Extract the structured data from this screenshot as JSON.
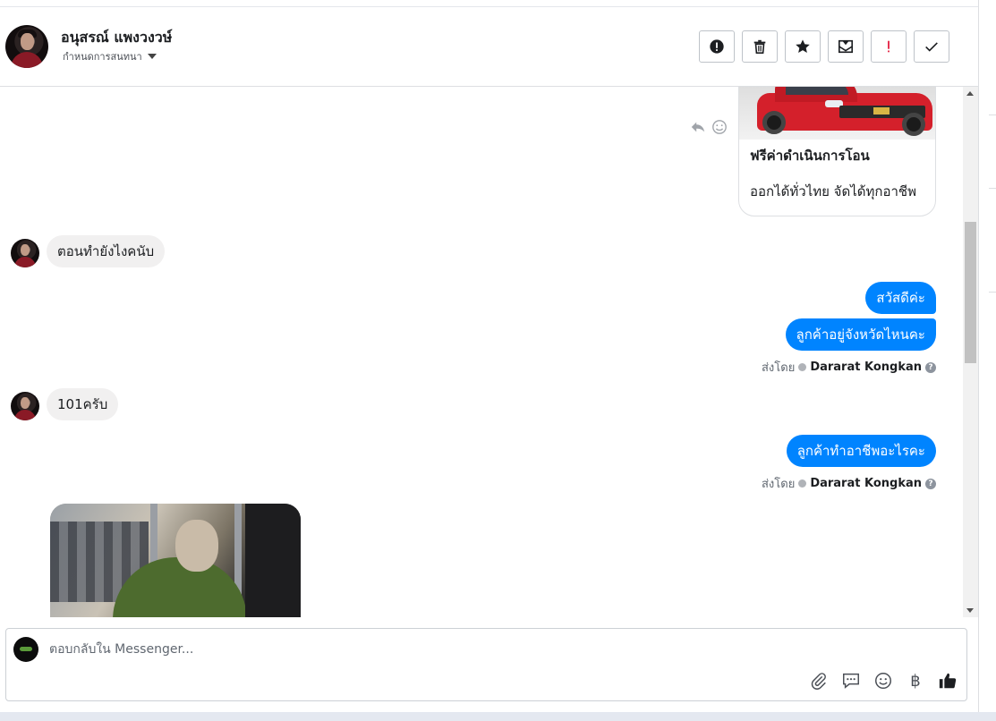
{
  "header": {
    "contact_name": "อนุสรณ์ แพงวงวษ์",
    "sub_label": "กำหนดการสนทนา",
    "toolbar": [
      {
        "icon": "alert-circle-icon"
      },
      {
        "icon": "trash-icon"
      },
      {
        "icon": "star-icon"
      },
      {
        "icon": "mark-unread-icon"
      },
      {
        "icon": "exclamation-icon"
      },
      {
        "icon": "check-icon"
      }
    ]
  },
  "card": {
    "title": "ฟรีค่าดำเนินการโอน",
    "description": "ออกได้ทั่วไทย จัดได้ทุกอาชีพ"
  },
  "messages": {
    "in_1": "ตอนทำยังไงคนับ",
    "out_1": "สวัสดีค่ะ",
    "out_2": "ลูกค้าอยู่จังหวัดไหนคะ",
    "in_2": "101ครับ",
    "out_3": "ลูกค้าทำอาชีพอะไรคะ"
  },
  "sent_by": {
    "prefix": "ส่งโดย",
    "agent": "Dararat Kongkan"
  },
  "composer": {
    "placeholder": "ตอบกลับใน Messenger...",
    "currency_symbol": "฿"
  },
  "colors": {
    "accent": "#0084ff",
    "incoming_bubble": "#f1f0f0",
    "exclamation": "#e41e3f"
  }
}
